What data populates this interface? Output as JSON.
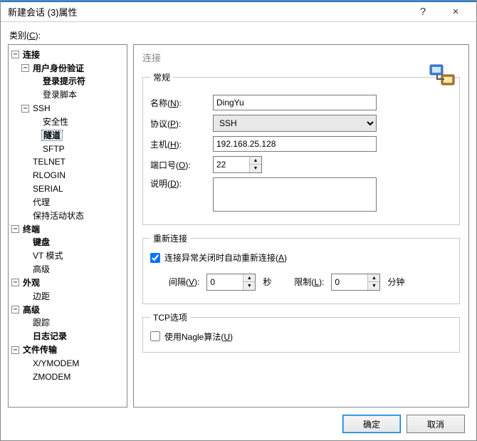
{
  "window": {
    "title": "新建会话 (3)属性",
    "help": "?",
    "close": "×"
  },
  "category_label": "类别(<u>C</u>):",
  "tree": {
    "n0": "连接",
    "n1": "用户身份验证",
    "n2": "登录提示符",
    "n3": "登录脚本",
    "n4": "SSH",
    "n5": "安全性",
    "n6": "隧道",
    "n7": "SFTP",
    "n8": "TELNET",
    "n9": "RLOGIN",
    "n10": "SERIAL",
    "n11": "代理",
    "n12": "保持活动状态",
    "n13": "终端",
    "n14": "键盘",
    "n15": "VT 模式",
    "n16": "高级",
    "n17": "外观",
    "n18": "边距",
    "n19": "高级",
    "n20": "跟踪",
    "n21": "日志记录",
    "n22": "文件传输",
    "n23": "X/YMODEM",
    "n24": "ZMODEM"
  },
  "panel": {
    "title": "连接",
    "general_legend": "常规",
    "name_label": "名称(<u>N</u>):",
    "name_value": "DingYu",
    "protocol_label": "协议(<u>P</u>):",
    "protocol_value": "SSH",
    "host_label": "主机(<u>H</u>):",
    "host_value": "192.168.25.128",
    "port_label": "端口号(<u>O</u>):",
    "port_value": "22",
    "desc_label": "说明(<u>D</u>):",
    "desc_value": "",
    "reconnect_legend": "重新连接",
    "autoreconnect_label": "连接异常关闭时自动重新连接(<u>A</u>)",
    "autoreconnect_checked": true,
    "interval_label": "间隔(<u>V</u>):",
    "interval_value": "0",
    "interval_unit": "秒",
    "limit_label": "限制(<u>L</u>):",
    "limit_value": "0",
    "limit_unit": "分钟",
    "tcp_legend": "TCP选项",
    "nagle_label": "使用Nagle算法(<u>U</u>)",
    "nagle_checked": false
  },
  "buttons": {
    "ok": "确定",
    "cancel": "取消"
  }
}
